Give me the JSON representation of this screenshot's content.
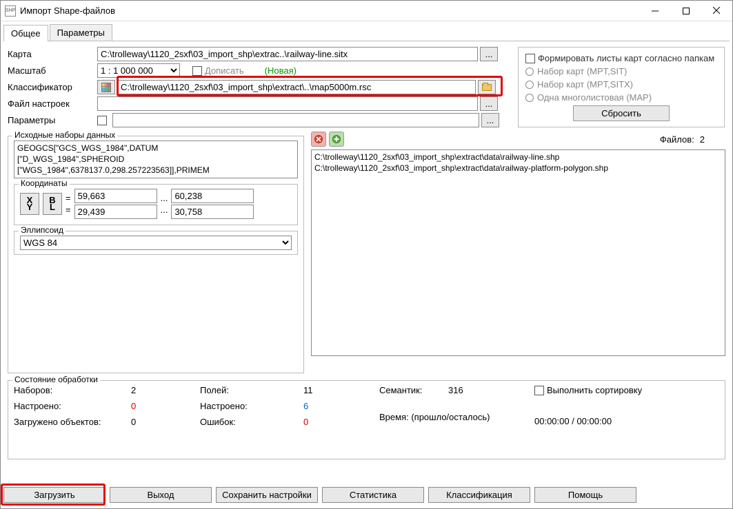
{
  "window": {
    "title": "Импорт Shape-файлов"
  },
  "tabs": {
    "general": "Общее",
    "params": "Параметры"
  },
  "form": {
    "map_label": "Карта",
    "map_value": "C:\\trolleway\\1120_2sxf\\03_import_shp\\extrac..\\railway-line.sitx",
    "browse": "...",
    "scale_label": "Масштаб",
    "scale_value": "1 : 1 000 000",
    "append": "Дописать",
    "new": "(Новая)",
    "classifier_label": "Классификатор",
    "classifier_value": "C:\\trolleway\\1120_2sxf\\03_import_shp\\extract\\..\\map5000m.rsc",
    "settings_label": "Файл настроек",
    "settings_value": "",
    "params_label": "Параметры",
    "params_value": ""
  },
  "right_panel": {
    "form_sheets": "Формировать листы карт согласно папкам",
    "opt1": "Набор карт (MPT,SIT)",
    "opt2": "Набор карт (MPT,SITX)",
    "opt3": "Одна многолистовая (MAP)",
    "reset": "Сбросить"
  },
  "sourcesets": {
    "legend": "Исходные наборы данных",
    "projection_text": "GEOGCS[\"GCS_WGS_1984\",DATUM\n[\"D_WGS_1984\",SPHEROID\n[\"WGS_1984\",6378137.0,298.257223563]],PRIMEM",
    "coords_legend": "Координаты",
    "btn_xy_top": "X",
    "btn_xy_bot": "Y",
    "btn_bl_top": "B",
    "btn_bl_bot": "L",
    "eq": "=",
    "x1": "59,663",
    "x2": "60,238",
    "y1": "29,439",
    "y2": "30,758",
    "dots": "...",
    "ellipsoid_legend": "Эллипсоид",
    "ellipsoid_value": "WGS 84"
  },
  "files": {
    "count_label": "Файлов:",
    "count": "2",
    "list": "C:\\trolleway\\1120_2sxf\\03_import_shp\\extract\\data\\railway-line.shp\nC:\\trolleway\\1120_2sxf\\03_import_shp\\extract\\data\\railway-platform-polygon.shp"
  },
  "status": {
    "legend": "Состояние обработки",
    "sets_l": "Наборов:",
    "sets_v": "2",
    "cfg_l": "Настроено:",
    "cfg_v": "0",
    "loaded_l": "Загружено объектов:",
    "loaded_v": "0",
    "fields_l": "Полей:",
    "fields_v": "11",
    "fcfg_l": "Настроено:",
    "fcfg_v": "6",
    "err_l": "Ошибок:",
    "err_v": "0",
    "sem_l": "Семантик:",
    "sem_v": "316",
    "time_l": "Время: (прошло/осталось)",
    "time_v": "00:00:00 / 00:00:00",
    "sort": "Выполнить сортировку"
  },
  "buttons": {
    "load": "Загрузить",
    "exit": "Выход",
    "save": "Сохранить настройки",
    "stats": "Статистика",
    "classify": "Классификация",
    "help": "Помощь"
  }
}
